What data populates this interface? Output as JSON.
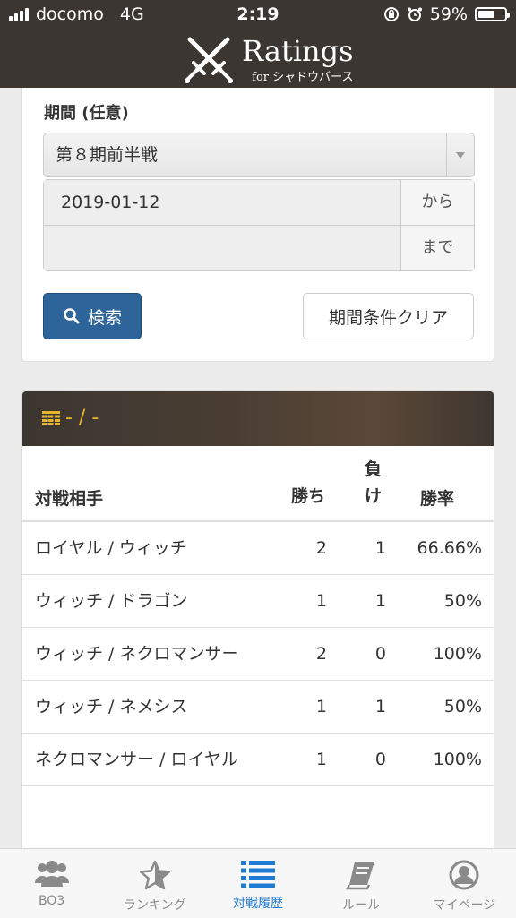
{
  "status_bar": {
    "carrier": "docomo",
    "network": "4G",
    "time": "2:19",
    "battery": "59%"
  },
  "header": {
    "logo_title": "Ratings",
    "logo_subtitle": "for シャドウバース"
  },
  "filter": {
    "period_label": "期間 (任意)",
    "period_select": "第８期前半戦",
    "from_value": "2019-01-12",
    "from_addon": "から",
    "to_value": "",
    "to_addon": "まで",
    "search_button": "検索",
    "clear_button": "期間条件クリア"
  },
  "results": {
    "panel_title": "- / -",
    "columns": [
      "対戦相手",
      "勝ち",
      "負け",
      "勝率"
    ],
    "rows": [
      {
        "opponent": "ロイヤル / ウィッチ",
        "win": "2",
        "lose": "1",
        "rate": "66.66%"
      },
      {
        "opponent": "ウィッチ / ドラゴン",
        "win": "1",
        "lose": "1",
        "rate": "50%"
      },
      {
        "opponent": "ウィッチ / ネクロマンサー",
        "win": "2",
        "lose": "0",
        "rate": "100%"
      },
      {
        "opponent": "ウィッチ / ネメシス",
        "win": "1",
        "lose": "1",
        "rate": "50%"
      },
      {
        "opponent": "ネクロマンサー / ロイヤル",
        "win": "1",
        "lose": "0",
        "rate": "100%"
      }
    ]
  },
  "tabbar": {
    "items": [
      {
        "label": "BO3",
        "icon": "users-icon"
      },
      {
        "label": "ランキング",
        "icon": "star-icon"
      },
      {
        "label": "対戦履歴",
        "icon": "list-icon"
      },
      {
        "label": "ルール",
        "icon": "book-icon"
      },
      {
        "label": "マイページ",
        "icon": "user-circle-icon"
      }
    ]
  },
  "colors": {
    "header_bg": "#3b3631",
    "accent_gold": "#e7b52a",
    "primary_button": "#2d659a",
    "active_tab": "#1f7ad4"
  }
}
